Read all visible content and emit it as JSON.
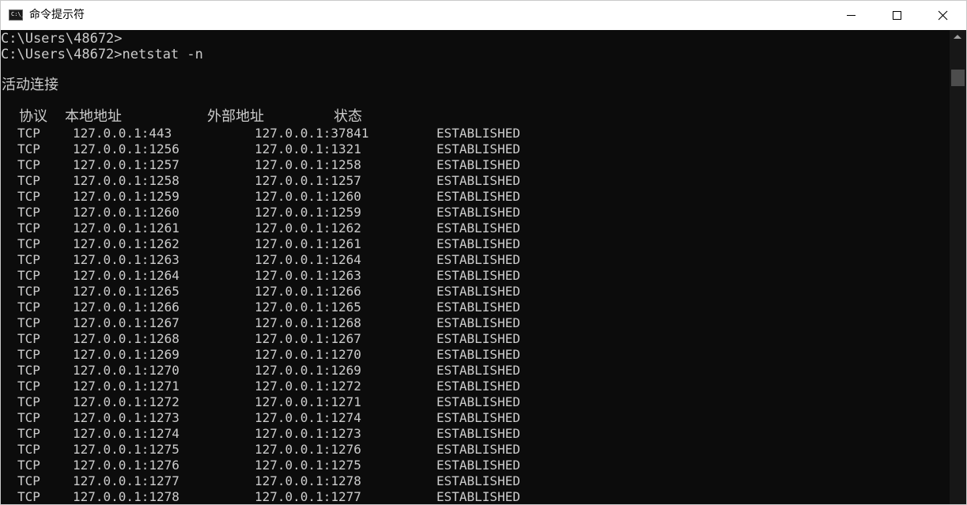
{
  "window": {
    "title": "命令提示符",
    "icon": "cmd-app-icon",
    "icon_text": "C:\\_"
  },
  "console": {
    "prompt_lines": [
      "C:\\Users\\48672>",
      "C:\\Users\\48672>netstat -n"
    ],
    "section_title": "活动连接",
    "headers": {
      "proto": "协议",
      "local": "本地地址",
      "remote": "外部地址",
      "state": "状态"
    },
    "rows": [
      {
        "proto": "TCP",
        "local": "127.0.0.1:443",
        "remote": "127.0.0.1:37841",
        "state": "ESTABLISHED"
      },
      {
        "proto": "TCP",
        "local": "127.0.0.1:1256",
        "remote": "127.0.0.1:1321",
        "state": "ESTABLISHED"
      },
      {
        "proto": "TCP",
        "local": "127.0.0.1:1257",
        "remote": "127.0.0.1:1258",
        "state": "ESTABLISHED"
      },
      {
        "proto": "TCP",
        "local": "127.0.0.1:1258",
        "remote": "127.0.0.1:1257",
        "state": "ESTABLISHED"
      },
      {
        "proto": "TCP",
        "local": "127.0.0.1:1259",
        "remote": "127.0.0.1:1260",
        "state": "ESTABLISHED"
      },
      {
        "proto": "TCP",
        "local": "127.0.0.1:1260",
        "remote": "127.0.0.1:1259",
        "state": "ESTABLISHED"
      },
      {
        "proto": "TCP",
        "local": "127.0.0.1:1261",
        "remote": "127.0.0.1:1262",
        "state": "ESTABLISHED"
      },
      {
        "proto": "TCP",
        "local": "127.0.0.1:1262",
        "remote": "127.0.0.1:1261",
        "state": "ESTABLISHED"
      },
      {
        "proto": "TCP",
        "local": "127.0.0.1:1263",
        "remote": "127.0.0.1:1264",
        "state": "ESTABLISHED"
      },
      {
        "proto": "TCP",
        "local": "127.0.0.1:1264",
        "remote": "127.0.0.1:1263",
        "state": "ESTABLISHED"
      },
      {
        "proto": "TCP",
        "local": "127.0.0.1:1265",
        "remote": "127.0.0.1:1266",
        "state": "ESTABLISHED"
      },
      {
        "proto": "TCP",
        "local": "127.0.0.1:1266",
        "remote": "127.0.0.1:1265",
        "state": "ESTABLISHED"
      },
      {
        "proto": "TCP",
        "local": "127.0.0.1:1267",
        "remote": "127.0.0.1:1268",
        "state": "ESTABLISHED"
      },
      {
        "proto": "TCP",
        "local": "127.0.0.1:1268",
        "remote": "127.0.0.1:1267",
        "state": "ESTABLISHED"
      },
      {
        "proto": "TCP",
        "local": "127.0.0.1:1269",
        "remote": "127.0.0.1:1270",
        "state": "ESTABLISHED"
      },
      {
        "proto": "TCP",
        "local": "127.0.0.1:1270",
        "remote": "127.0.0.1:1269",
        "state": "ESTABLISHED"
      },
      {
        "proto": "TCP",
        "local": "127.0.0.1:1271",
        "remote": "127.0.0.1:1272",
        "state": "ESTABLISHED"
      },
      {
        "proto": "TCP",
        "local": "127.0.0.1:1272",
        "remote": "127.0.0.1:1271",
        "state": "ESTABLISHED"
      },
      {
        "proto": "TCP",
        "local": "127.0.0.1:1273",
        "remote": "127.0.0.1:1274",
        "state": "ESTABLISHED"
      },
      {
        "proto": "TCP",
        "local": "127.0.0.1:1274",
        "remote": "127.0.0.1:1273",
        "state": "ESTABLISHED"
      },
      {
        "proto": "TCP",
        "local": "127.0.0.1:1275",
        "remote": "127.0.0.1:1276",
        "state": "ESTABLISHED"
      },
      {
        "proto": "TCP",
        "local": "127.0.0.1:1276",
        "remote": "127.0.0.1:1275",
        "state": "ESTABLISHED"
      },
      {
        "proto": "TCP",
        "local": "127.0.0.1:1277",
        "remote": "127.0.0.1:1278",
        "state": "ESTABLISHED"
      },
      {
        "proto": "TCP",
        "local": "127.0.0.1:1278",
        "remote": "127.0.0.1:1277",
        "state": "ESTABLISHED"
      }
    ]
  },
  "window_controls": {
    "minimize_icon": "minimize-icon",
    "maximize_icon": "maximize-icon",
    "close_icon": "close-icon"
  },
  "colors": {
    "console_bg": "#0c0c0c",
    "console_text": "#cccccc",
    "titlebar_bg": "#ffffff"
  }
}
